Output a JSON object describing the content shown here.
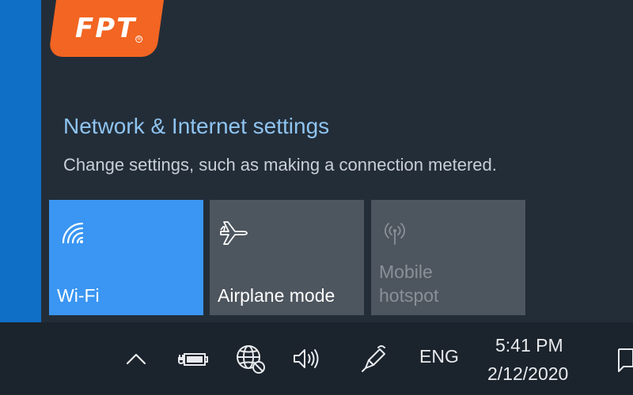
{
  "brand": {
    "logo_text": "FPT",
    "logo_mark": "®",
    "color": "#f26522"
  },
  "flyout": {
    "settings_link": "Network & Internet settings",
    "settings_desc": "Change settings, such as making a connection metered."
  },
  "tiles": [
    {
      "label": "Wi-Fi",
      "icon": "wifi-icon",
      "state": "on",
      "color": "#3a96f2"
    },
    {
      "label": "Airplane mode",
      "icon": "airplane-icon",
      "state": "off",
      "color": "#4d555e"
    },
    {
      "label_line1": "Mobile",
      "label_line2": "hotspot",
      "icon": "hotspot-icon",
      "state": "disabled",
      "color": "#4d555e"
    }
  ],
  "taskbar": {
    "tray_icons": [
      "chevron-up-icon",
      "battery-icon",
      "network-globe-icon",
      "volume-icon",
      "pen-icon",
      "notification-icon"
    ],
    "language": "ENG",
    "time": "5:41 PM",
    "date": "2/12/2020"
  }
}
